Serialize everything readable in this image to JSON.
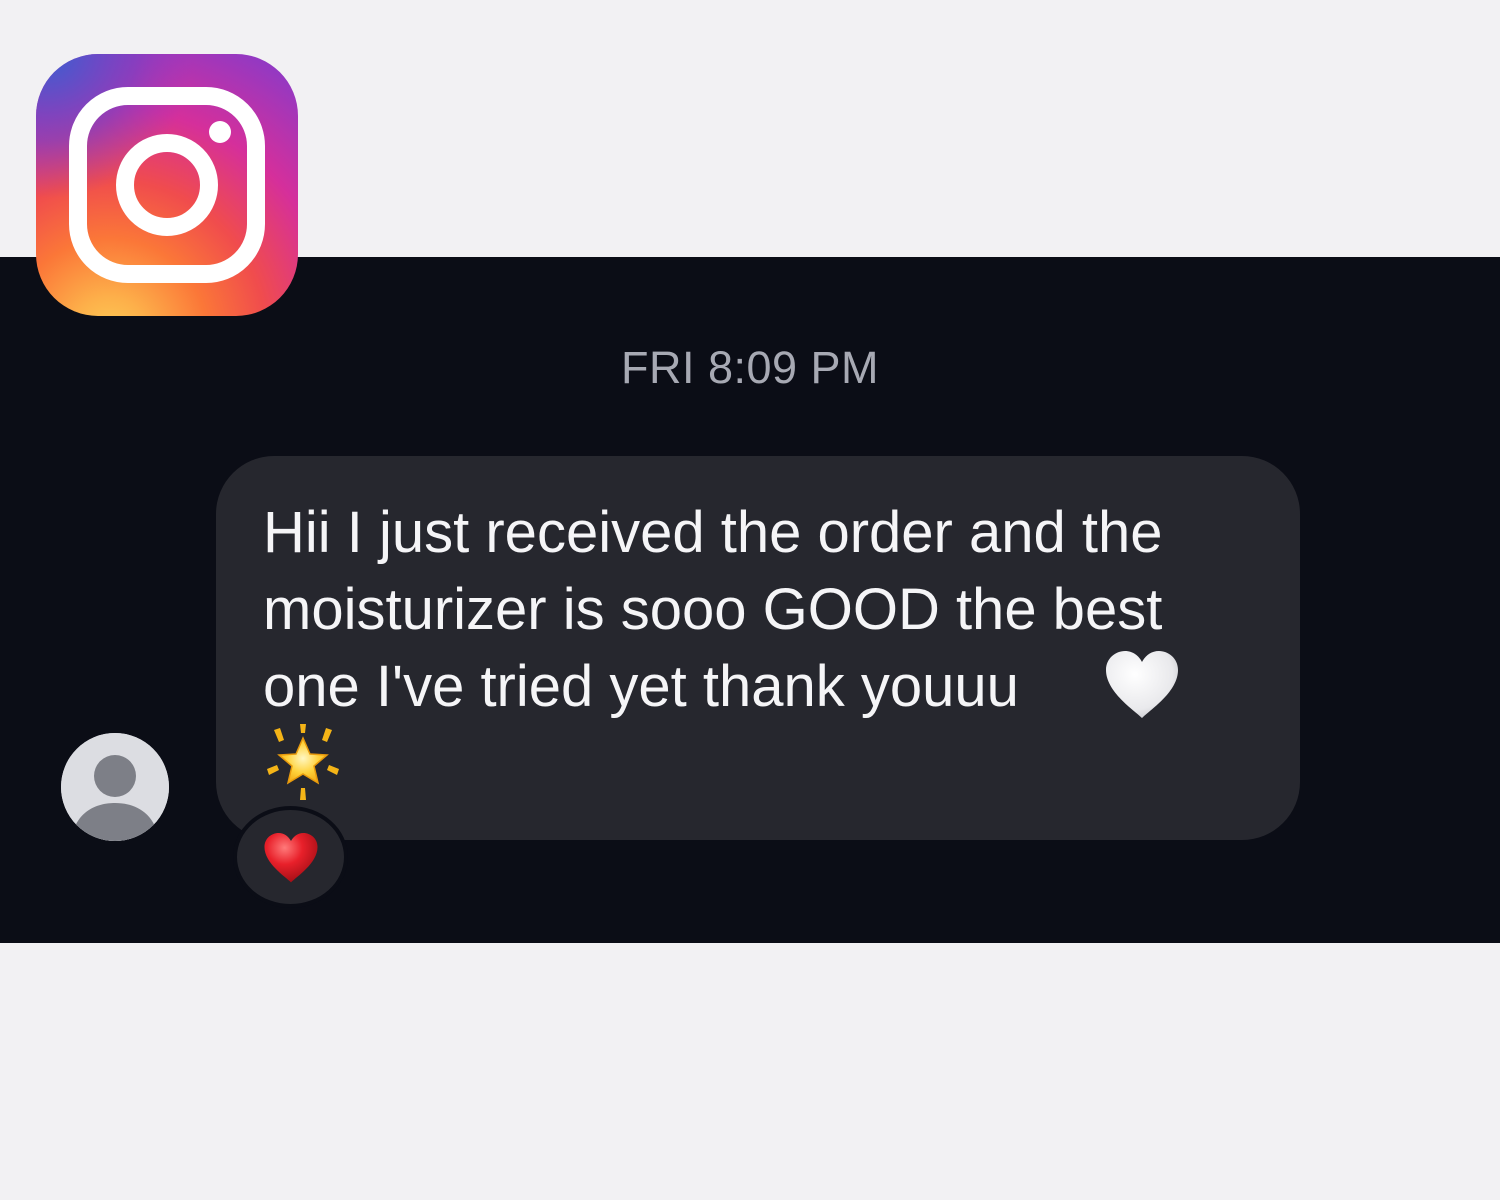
{
  "app": {
    "logo_icon": "instagram-logo",
    "panel_color": "#0b0d16",
    "page_background": "#f2f1f3"
  },
  "thread": {
    "timestamp": "FRI 8:09 PM",
    "message": {
      "text": "Hii I just received the order and the\nmoisturizer is sooo GOOD the best\none I've tried yet thank youuu",
      "emojis": [
        "white-heart-icon",
        "glowing-star-icon"
      ],
      "bubble_color": "#26272e"
    },
    "sender_avatar_icon": "default-avatar-icon",
    "reaction_icon": "red-heart-icon"
  }
}
